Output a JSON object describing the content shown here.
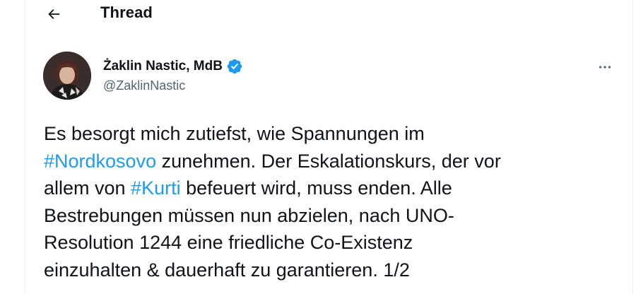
{
  "header": {
    "back_icon": "arrow-left-icon",
    "title": "Thread"
  },
  "tweet": {
    "author": {
      "name": "Żaklin Nastic, MdB",
      "handle": "@ZaklinNastic",
      "verified": true,
      "verified_icon": "verified-badge-icon",
      "verified_color": "#1d9bf0",
      "avatar_icon": "user-avatar"
    },
    "more_icon": "more-horizontal-icon",
    "text": {
      "line1": "Es besorgt mich zutiefst, wie Spannungen im",
      "hashtag1": "#Nordkosovo",
      "line2_rest": " zunehmen. Der Eskalationskurs, der vor",
      "line3_start": "allem von ",
      "hashtag2": "#Kurti",
      "line3_rest": " befeuert wird, muss enden. Alle",
      "line4": "Bestrebungen müssen nun abzielen, nach UNO-",
      "line5": "Resolution 1244 eine friedliche Co-Existenz",
      "line6": "einzuhalten & dauerhaft zu garantieren. 1/2"
    }
  },
  "colors": {
    "text_primary": "#0f1419",
    "text_secondary": "#536471",
    "accent": "#1d9bf0",
    "border": "#eff3f4"
  }
}
